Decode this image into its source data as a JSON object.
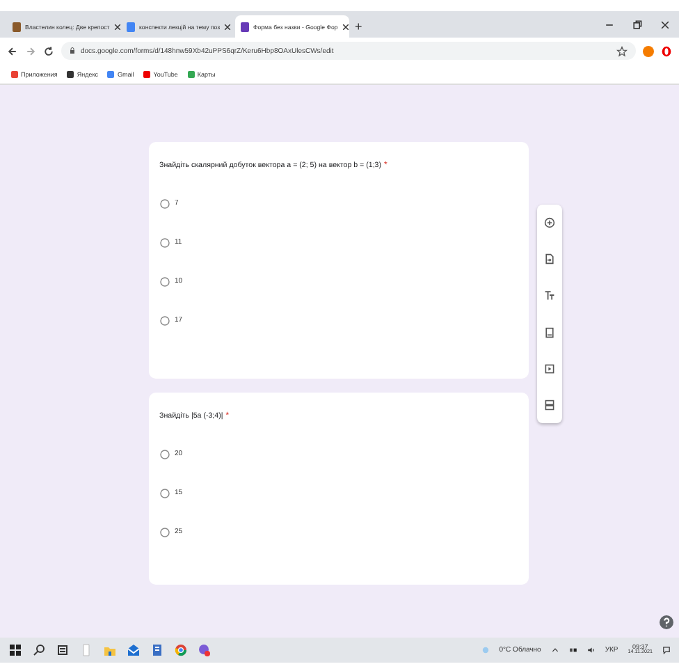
{
  "browser": {
    "tabs": [
      {
        "title": "Властелин колец: Две крепост",
        "selected": false,
        "kind": "book"
      },
      {
        "title": "конспекти лекцій на тему поз",
        "selected": false,
        "kind": "google"
      },
      {
        "title": "Форма без назви - Google Фор",
        "selected": true,
        "kind": "forms"
      }
    ],
    "new_tab": "+",
    "address": "docs.google.com/forms/d/148hnw59Xb42uPPS6qrZ/Keru6Hbp8OAxUlesCWs/edit",
    "bookmarks": [
      {
        "label": "Приложения",
        "kind": "apps"
      },
      {
        "label": "Яндекс",
        "kind": "yandex"
      },
      {
        "label": "Gmail",
        "kind": "google"
      },
      {
        "label": "YouTube",
        "kind": "youtube"
      },
      {
        "label": "Карты",
        "kind": "maps"
      }
    ]
  },
  "questions": [
    {
      "text": "Знайдіть скалярний добуток вектора a = (2; 5) на вектор b = (1;3)",
      "required_mark": "*",
      "options": [
        {
          "label": "7",
          "selected": false
        },
        {
          "label": "11",
          "selected": false
        },
        {
          "label": "10",
          "selected": false
        },
        {
          "label": "17",
          "selected": false
        }
      ]
    },
    {
      "text": "Знайдіть |5a (-3;4)|",
      "required_mark": "*",
      "options": [
        {
          "label": "20",
          "selected": false
        },
        {
          "label": "15",
          "selected": false
        },
        {
          "label": "25",
          "selected": false
        }
      ]
    }
  ],
  "taskbar": {
    "weather": "0°C Облачно",
    "language": "УКР",
    "time": "09:37",
    "date": "14.11.2021"
  }
}
